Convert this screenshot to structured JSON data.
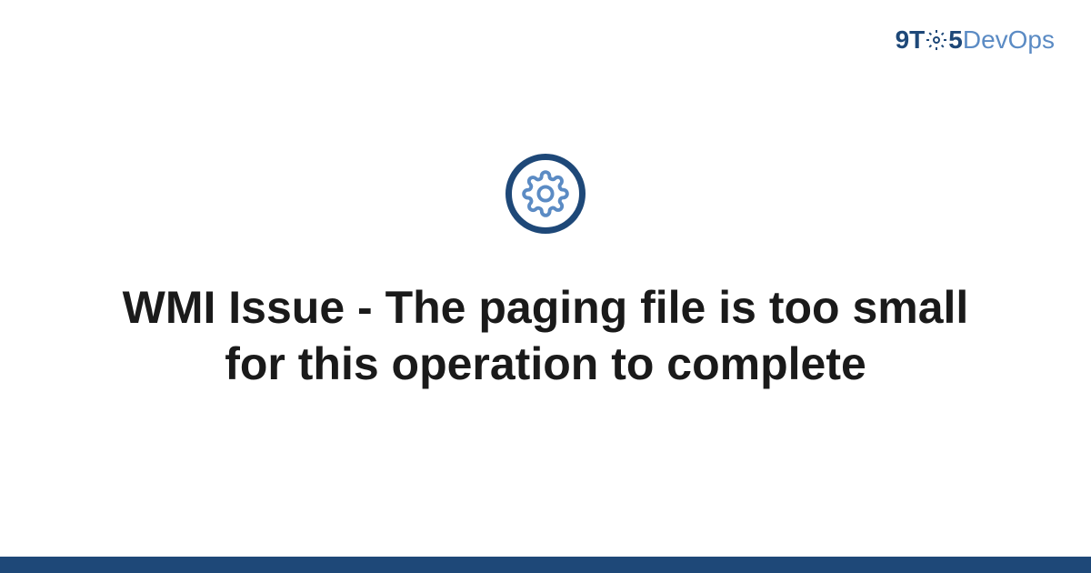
{
  "logo": {
    "part1": "9T",
    "part2": "5",
    "part3": "DevOps"
  },
  "title": "WMI Issue - The paging file is too small for this operation to complete",
  "colors": {
    "primary": "#1e4878",
    "secondary": "#5b8bc4"
  }
}
